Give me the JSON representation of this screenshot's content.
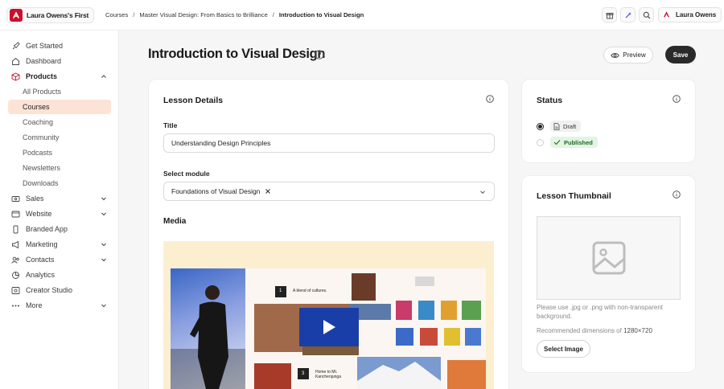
{
  "brand": {
    "name": "Laura Owens's First"
  },
  "breadcrumb": {
    "items": [
      "Courses",
      "Master Visual Design: From Basics to Brilliance",
      "Introduction to Visual Design"
    ],
    "separator": "/"
  },
  "topbar": {
    "icons": [
      "gift-icon",
      "sparkle-icon",
      "search-icon"
    ],
    "user_name": "Laura Owens"
  },
  "sidebar": {
    "items": [
      {
        "label": "Get Started",
        "icon": "rocket-icon"
      },
      {
        "label": "Dashboard",
        "icon": "home-icon"
      },
      {
        "label": "Products",
        "icon": "box-icon",
        "expanded": true
      },
      {
        "label": "Sales",
        "icon": "dollar-icon"
      },
      {
        "label": "Website",
        "icon": "globe-icon"
      },
      {
        "label": "Branded App",
        "icon": "phone-icon"
      },
      {
        "label": "Marketing",
        "icon": "megaphone-icon"
      },
      {
        "label": "Contacts",
        "icon": "contacts-icon"
      },
      {
        "label": "Analytics",
        "icon": "chart-icon"
      },
      {
        "label": "Creator Studio",
        "icon": "studio-icon"
      },
      {
        "label": "More",
        "icon": "dots-icon"
      }
    ],
    "products_sub": [
      "All Products",
      "Courses",
      "Coaching",
      "Community",
      "Podcasts",
      "Newsletters",
      "Downloads"
    ],
    "active_sub": "Courses"
  },
  "header": {
    "title": "Introduction to Visual Design",
    "preview_label": "Preview",
    "save_label": "Save"
  },
  "lesson": {
    "card_title": "Lesson Details",
    "title_label": "Title",
    "title_value": "Understanding Design Principles",
    "module_label": "Select module",
    "module_value": "Foundations of Visual Design",
    "media_label": "Media",
    "slide_captions": [
      "A blend of cultures.",
      "Home to Mt. Kanchenjunga"
    ],
    "slide_numbers": [
      "1",
      "3"
    ]
  },
  "status": {
    "card_title": "Status",
    "options": [
      {
        "label": "Draft",
        "selected": true
      },
      {
        "label": "Published",
        "selected": false
      }
    ]
  },
  "thumbnail": {
    "card_title": "Lesson Thumbnail",
    "hint_line1": "Please use .jpg or .png with non-transparent",
    "hint_line2": "background.",
    "dims_prefix": "Recommended dimensions of",
    "dims_value": "1280×720",
    "select_label": "Select Image"
  },
  "colors": {
    "accent_active_bg": "#fde3d6",
    "brand": "#c8102e",
    "save_bg": "#2a2a2a",
    "published_bg": "#e3f4e3",
    "published_fg": "#1d6a27",
    "play_bg": "#1a3ea8"
  }
}
